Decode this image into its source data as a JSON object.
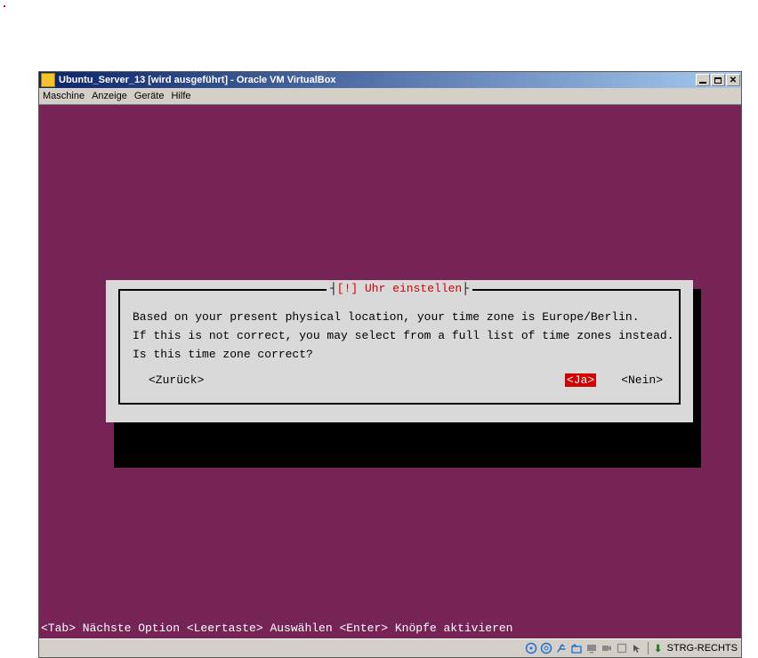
{
  "window": {
    "title": "Ubuntu_Server_13 [wird ausgeführt] - Oracle VM VirtualBox"
  },
  "menu": {
    "machine": "Maschine",
    "view": "Anzeige",
    "devices": "Geräte",
    "help": "Hilfe"
  },
  "dialog": {
    "title_bang": "[!]",
    "title_text": "Uhr einstellen",
    "line1": "Based on your present physical location, your time zone is Europe/Berlin.",
    "line2": "If this is not correct, you may select from a full list of time zones instead.",
    "line3": "Is this time zone correct?",
    "back": "<Zurück>",
    "yes": "<Ja>",
    "no": "<Nein>"
  },
  "hint": "<Tab> Nächste Option <Leertaste> Auswählen <Enter> Knöpfe aktivieren",
  "status": {
    "host_key": "STRG-RECHTS"
  }
}
